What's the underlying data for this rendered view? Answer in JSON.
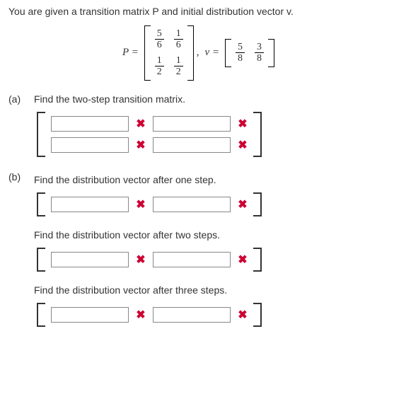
{
  "intro": "You are given a transition matrix P and initial distribution vector v.",
  "equation": {
    "P_label": "P =",
    "P": [
      [
        "5",
        "6",
        "1",
        "6"
      ],
      [
        "1",
        "2",
        "1",
        "2"
      ]
    ],
    "comma": ", ",
    "v_label": "v =",
    "v": [
      "5",
      "8",
      "3",
      "8"
    ]
  },
  "parts": {
    "a": {
      "label": "(a)",
      "prompt": "Find the two-step transition matrix."
    },
    "b": {
      "label": "(b)",
      "p1": "Find the distribution vector after one step.",
      "p2": "Find the distribution vector after two steps.",
      "p3": "Find the distribution vector after three steps."
    }
  },
  "icons": {
    "wrong": "✖"
  }
}
